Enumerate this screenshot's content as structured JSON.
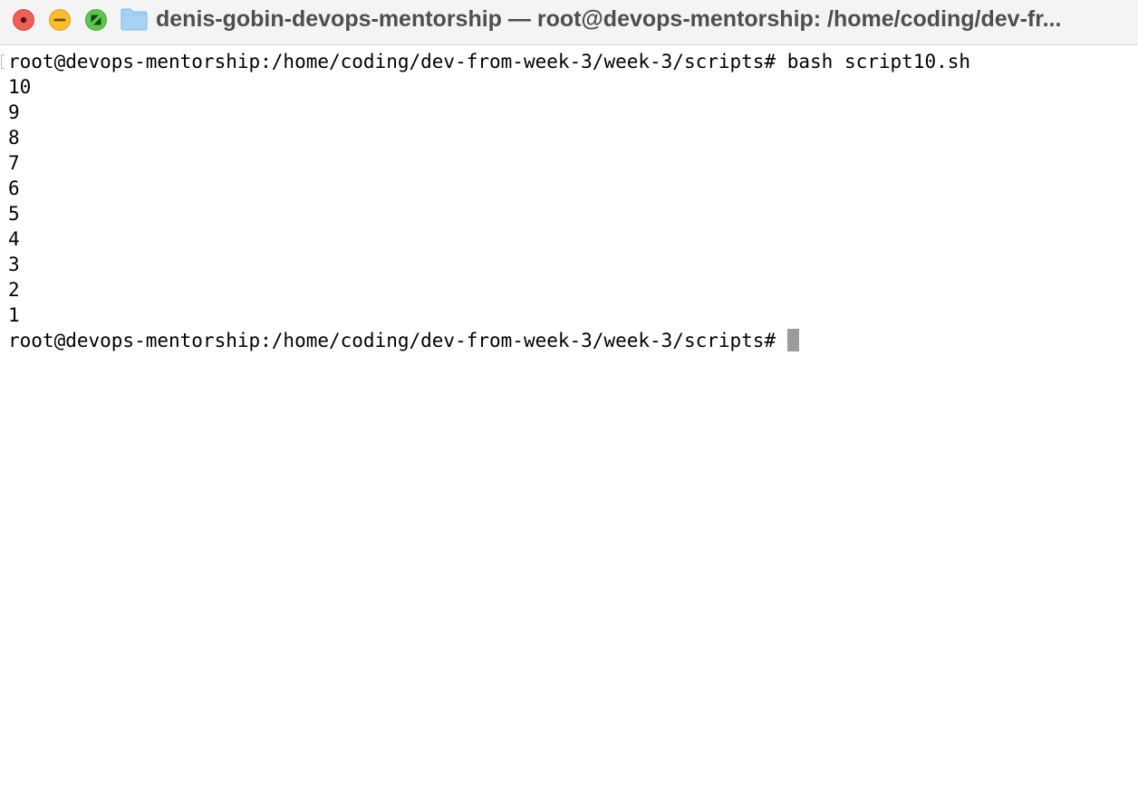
{
  "window": {
    "title": "denis-gobin-devops-mentorship — root@devops-mentorship: /home/coding/dev-fr...",
    "icon": "folder-icon",
    "controls": {
      "close_icon": "close-icon",
      "minimize_icon": "minimize-icon",
      "zoom_icon": "zoom-icon"
    }
  },
  "colors": {
    "close": "#ee5f58",
    "minimize": "#f8bd2f",
    "zoom": "#5fc454",
    "folder": "#a9d3f5",
    "cursor": "#9b9b9b"
  },
  "terminal": {
    "prompt": "root@devops-mentorship:/home/coding/dev-from-week-3/week-3/scripts#",
    "command": "bash script10.sh",
    "output": [
      "10",
      "9",
      "8",
      "7",
      "6",
      "5",
      "4",
      "3",
      "2",
      "1"
    ]
  }
}
